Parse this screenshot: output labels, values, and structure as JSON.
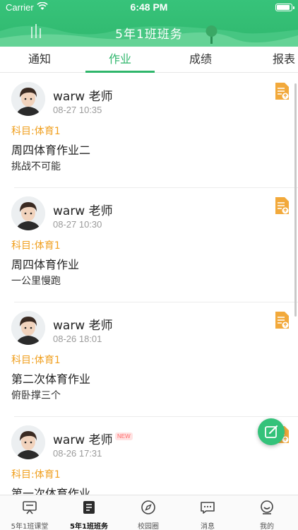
{
  "status_bar": {
    "carrier": "Carrier",
    "time": "6:48 PM",
    "battery_level": 0.9
  },
  "header": {
    "title": "5年1班班务"
  },
  "tabs": [
    {
      "label": "通知",
      "active": false
    },
    {
      "label": "作业",
      "active": true
    },
    {
      "label": "成绩",
      "active": false
    },
    {
      "label": "报表",
      "active": false
    }
  ],
  "homework": [
    {
      "teacher": "warw 老师",
      "time": "08-27 10:35",
      "subject": "科目:体育1",
      "title": "周四体育作业二",
      "desc": "挑战不可能",
      "is_new": false
    },
    {
      "teacher": "warw 老师",
      "time": "08-27 10:30",
      "subject": "科目:体育1",
      "title": "周四体育作业",
      "desc": "一公里慢跑",
      "is_new": false
    },
    {
      "teacher": "warw 老师",
      "time": "08-26 18:01",
      "subject": "科目:体育1",
      "title": "第二次体育作业",
      "desc": "俯卧撑三个",
      "is_new": false
    },
    {
      "teacher": "warw 老师",
      "time": "08-26 17:31",
      "subject": "科目:体育1",
      "title": "第一次体育作业",
      "desc": "",
      "is_new": true,
      "badge": "NEW"
    }
  ],
  "bottom_tabs": [
    {
      "label": "5年1班课堂",
      "icon": "classroom-icon",
      "active": false
    },
    {
      "label": "5年1班班务",
      "icon": "class-affairs-icon",
      "active": true
    },
    {
      "label": "校园圈",
      "icon": "compass-icon",
      "active": false
    },
    {
      "label": "消息",
      "icon": "message-icon",
      "active": false
    },
    {
      "label": "我的",
      "icon": "profile-icon",
      "active": false
    }
  ],
  "colors": {
    "primary": "#2fb66b",
    "subject": "#f0a020",
    "doc_icon": "#f2a93b"
  }
}
